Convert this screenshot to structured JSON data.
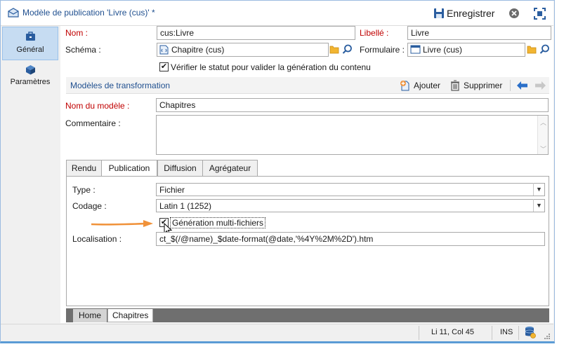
{
  "window": {
    "title": "Modèle de publication 'Livre (cus)' *",
    "save_label": "Enregistrer"
  },
  "sidebar": {
    "items": [
      {
        "label": "Général",
        "icon": "briefcase-icon",
        "active": true
      },
      {
        "label": "Paramètres",
        "icon": "cube-icon",
        "active": false
      }
    ]
  },
  "form": {
    "nom_label": "Nom :",
    "nom_value": "cus:Livre",
    "libelle_label": "Libellé :",
    "libelle_value": "Livre",
    "schema_label": "Schéma :",
    "schema_value": "Chapitre (cus)",
    "formulaire_label": "Formulaire :",
    "formulaire_value": "Livre (cus)",
    "verify_label": "Vérifier le statut pour valider la génération du contenu",
    "verify_checked": true
  },
  "transform": {
    "section_title": "Modèles de transformation",
    "add_label": "Ajouter",
    "delete_label": "Supprimer",
    "model_name_label": "Nom du modèle :",
    "model_name_value": "Chapitres",
    "comment_label": "Commentaire :",
    "comment_value": ""
  },
  "tabs": [
    {
      "label": "Rendu",
      "active": false
    },
    {
      "label": "Publication",
      "active": true
    },
    {
      "label": "Diffusion",
      "active": false
    },
    {
      "label": "Agrégateur",
      "active": false
    }
  ],
  "publication": {
    "type_label": "Type :",
    "type_value": "Fichier",
    "codage_label": "Codage :",
    "codage_value": "Latin 1 (1252)",
    "multi_label": "Génération multi-fichiers",
    "multi_checked": true,
    "localisation_label": "Localisation :",
    "localisation_value": "ct_$(/@name)_$date-format(@date,'%4Y%2M%2D').htm"
  },
  "bottom_tabs": [
    {
      "label": "Home",
      "active": false
    },
    {
      "label": "Chapitres",
      "active": true
    }
  ],
  "status": {
    "position": "Li 11, Col 45",
    "mode": "INS"
  },
  "colors": {
    "accent_blue": "#1f4f8f",
    "required_red": "#c00000",
    "arrow_orange": "#f0923a",
    "active_side": "#c6dcf2"
  }
}
